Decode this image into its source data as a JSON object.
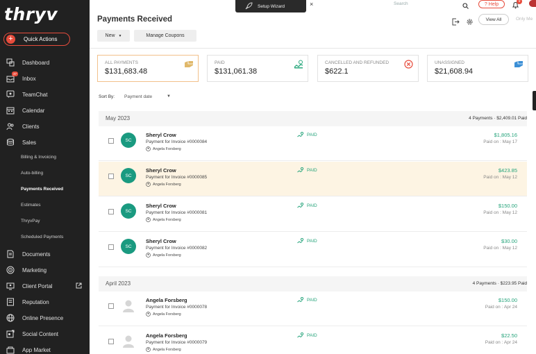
{
  "app": {
    "logo_text": "thryv"
  },
  "quick_actions": {
    "label": "Quick Actions",
    "plus": "+"
  },
  "sidebar": {
    "items": [
      {
        "label": "Dashboard",
        "icon": "dashboard-icon"
      },
      {
        "label": "Inbox",
        "icon": "inbox-icon",
        "badge": "37"
      },
      {
        "label": "TeamChat",
        "icon": "teamchat-icon"
      },
      {
        "label": "Calendar",
        "icon": "calendar-icon"
      },
      {
        "label": "Clients",
        "icon": "clients-icon"
      },
      {
        "label": "Sales",
        "icon": "sales-icon"
      }
    ],
    "sales_sub": [
      {
        "label": "Billing & Invoicing"
      },
      {
        "label": "Auto-billing"
      },
      {
        "label": "Payments Received"
      },
      {
        "label": "Estimates"
      },
      {
        "label": "ThryvPay"
      },
      {
        "label": "Scheduled Payments"
      }
    ],
    "items2": [
      {
        "label": "Documents",
        "icon": "documents-icon"
      },
      {
        "label": "Marketing",
        "icon": "marketing-icon"
      },
      {
        "label": "Client Portal",
        "icon": "client-portal-icon"
      },
      {
        "label": "Reputation",
        "icon": "reputation-icon"
      },
      {
        "label": "Online Presence",
        "icon": "online-presence-icon"
      },
      {
        "label": "Social Content",
        "icon": "social-content-icon"
      },
      {
        "label": "App Market",
        "icon": "app-market-icon"
      }
    ]
  },
  "topbar": {
    "wizard_label": "Setup Wizard",
    "close": "×",
    "search_placeholder": "Search",
    "help_label": "Help",
    "bell_badge": "9"
  },
  "header": {
    "title": "Payments Received",
    "new_label": "New",
    "coupons_label": "Manage Coupons",
    "view_all": "View All",
    "only_me": "Only Me"
  },
  "cards": [
    {
      "label": "ALL PAYMENTS",
      "value": "$131,683.48"
    },
    {
      "label": "PAID",
      "value": "$131,061.38"
    },
    {
      "label": "CANCELLED AND REFUNDED",
      "value": "$622.1"
    },
    {
      "label": "UNASSIGNED",
      "value": "$21,608.94"
    }
  ],
  "sort": {
    "label": "Sort By:",
    "value": "Payment date"
  },
  "groups": [
    {
      "month": "May 2023",
      "summary": "4 Payments  ·  $2,409.01 Paid",
      "rows": [
        {
          "initials": "SC",
          "name": "Sheryl Crow",
          "desc": "Payment for Invoice #0000084",
          "owner": "Angela Forsberg",
          "status": "PAID",
          "amount": "$1,805.16",
          "date": "Paid on : May 17"
        },
        {
          "initials": "SC",
          "name": "Sheryl Crow",
          "desc": "Payment for Invoice #0000085",
          "owner": "Angela Forsberg",
          "status": "PAID",
          "amount": "$423.85",
          "date": "Paid on : May 12"
        },
        {
          "initials": "SC",
          "name": "Sheryl Crow",
          "desc": "Payment for Invoice #0000081",
          "owner": "Angela Forsberg",
          "status": "PAID",
          "amount": "$150.00",
          "date": "Paid on : May 12"
        },
        {
          "initials": "SC",
          "name": "Sheryl Crow",
          "desc": "Payment for Invoice #0000082",
          "owner": "Angela Forsberg",
          "status": "PAID",
          "amount": "$30.00",
          "date": "Paid on : May 12"
        }
      ]
    },
    {
      "month": "April 2023",
      "summary": "4 Payments  ·  $223.95 Paid",
      "rows": [
        {
          "initials": "",
          "name": "Angela Forsberg",
          "desc": "Payment for Invoice #0000078",
          "owner": "Angela Forsberg",
          "status": "PAID",
          "amount": "$150.00",
          "date": "Paid on : Apr 24"
        },
        {
          "initials": "",
          "name": "Angela Forsberg",
          "desc": "Payment for Invoice #0000079",
          "owner": "Angela Forsberg",
          "status": "PAID",
          "amount": "$22.50",
          "date": "Paid on : Apr 24"
        }
      ]
    }
  ],
  "colors": {
    "sidebar_bg": "#212121",
    "accent": "#e74c3c",
    "paid_green": "#24a37a",
    "avatar_teal": "#1a9a80",
    "highlight_row": "#fdf4e3"
  }
}
